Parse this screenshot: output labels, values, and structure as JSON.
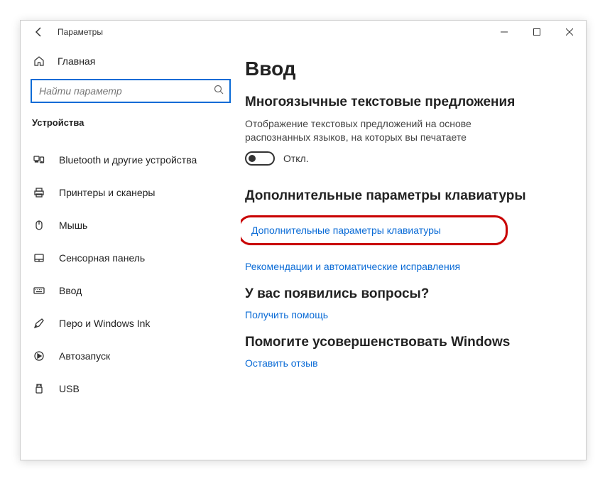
{
  "titlebar": {
    "title": "Параметры"
  },
  "sidebar": {
    "home": "Главная",
    "search_placeholder": "Найти параметр",
    "section": "Устройства",
    "items": [
      {
        "label": "Bluetooth и другие устройства"
      },
      {
        "label": "Принтеры и сканеры"
      },
      {
        "label": "Мышь"
      },
      {
        "label": "Сенсорная панель"
      },
      {
        "label": "Ввод"
      },
      {
        "label": "Перо и Windows Ink"
      },
      {
        "label": "Автозапуск"
      },
      {
        "label": "USB"
      }
    ]
  },
  "content": {
    "heading": "Ввод",
    "section1": {
      "title": "Многоязычные текстовые предложения",
      "desc": "Отображение текстовых предложений на основе распознанных языков, на которых вы печатаете",
      "toggle_state": "Откл."
    },
    "section2": {
      "title": "Дополнительные параметры клавиатуры",
      "link1": "Дополнительные параметры клавиатуры",
      "link2": "Рекомендации и автоматические исправления"
    },
    "section3": {
      "title": "У вас появились вопросы?",
      "link": "Получить помощь"
    },
    "section4": {
      "title": "Помогите усовершенствовать Windows",
      "link": "Оставить отзыв"
    }
  }
}
